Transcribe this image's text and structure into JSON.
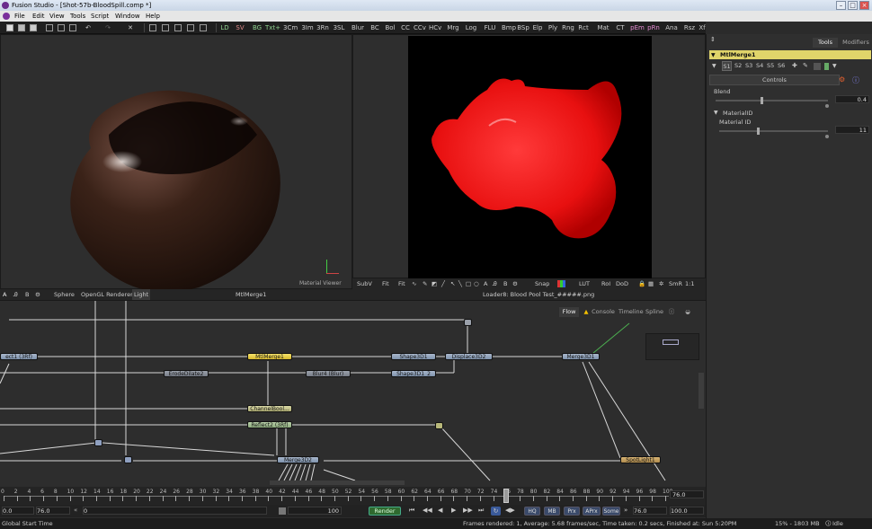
{
  "window": {
    "title": "Fusion Studio - [Shot-57b-BloodSpill.comp *]"
  },
  "menu": [
    "File",
    "Edit",
    "View",
    "Tools",
    "Script",
    "Window",
    "Help"
  ],
  "toolbar": {
    "tools": [
      "LD",
      "SV",
      "BG",
      "Txt+",
      "3Cm",
      "3Im",
      "3Rn",
      "3SL",
      "Blur",
      "BC",
      "Bol",
      "CC",
      "CCv",
      "HCv",
      "Mrg",
      "Log",
      "FLU",
      "Bmp",
      "BSp",
      "Elp",
      "Ply",
      "Rng",
      "Rct",
      "Mat",
      "CT",
      "pEm",
      "pRn",
      "Ana",
      "Rsz",
      "Xf"
    ]
  },
  "left_viewer": {
    "overlay_label": "Material Viewer",
    "bar": {
      "sphere": "Sphere",
      "renderer": "OpenGL Renderer",
      "light": "Light",
      "node": "MtlMerge1"
    }
  },
  "right_viewer": {
    "bar": {
      "subv": "SubV",
      "fit1": "Fit",
      "fit2": "Fit",
      "snap": "Snap",
      "lut": "LUT",
      "roi": "RoI",
      "dod": "DoD",
      "smr": "SmR",
      "ratio": "1:1"
    },
    "caption": "Loader8: Blood Pool Test_#####.png"
  },
  "inspector": {
    "tabs": {
      "tools": "Tools",
      "modifiers": "Modifiers"
    },
    "node_title": "MtlMerge1",
    "slots": [
      "S1",
      "S2",
      "S3",
      "S4",
      "S5",
      "S6"
    ],
    "controls_label": "Controls",
    "blend": {
      "label": "Blend",
      "value": "0.4"
    },
    "material_group": "MaterialID",
    "material_id": {
      "label": "Material ID",
      "value": "11"
    }
  },
  "flow_tabs": {
    "flow": "Flow",
    "console": "Console",
    "timeline": "Timeline",
    "spline": "Spline"
  },
  "nodes": {
    "reflect1": "ect1 (3Rf)",
    "mtlmerge1": "MtlMerge1",
    "shape3d1": "Shape3D1",
    "displace3d2": "Displace3D2",
    "merge3d1": "Merge3D1",
    "erodedilate2": "ErodeDilate2",
    "blur4": "Blur4 (Blur)",
    "shape3d1_2": "Shape3D1_2",
    "channelbool": "ChannelBool...",
    "reflect2": "Reflect2 (3Rf)",
    "merge3d2": "Merge3D2",
    "spotlight1": "SpotLight1"
  },
  "timeline": {
    "ticks": [
      "0",
      "2",
      "4",
      "6",
      "8",
      "10",
      "12",
      "14",
      "16",
      "18",
      "20",
      "22",
      "24",
      "26",
      "28",
      "30",
      "32",
      "34",
      "36",
      "38",
      "40",
      "42",
      "44",
      "46",
      "48",
      "50",
      "52",
      "54",
      "56",
      "58",
      "60",
      "62",
      "64",
      "66",
      "68",
      "70",
      "72",
      "74",
      "76",
      "78",
      "80",
      "82",
      "84",
      "86",
      "88",
      "90",
      "92",
      "94",
      "96",
      "98",
      "100"
    ],
    "end_value": "76.0"
  },
  "transport": {
    "start": "0.0",
    "render_end": "76.0",
    "current": "0",
    "zoom": "100",
    "render": "Render",
    "hq": "HQ",
    "mb": "MB",
    "prx": "Prx",
    "aprx": "APrx",
    "some": "Some",
    "end": "76.0",
    "global_end": "100.0"
  },
  "status": {
    "left": "Global Start Time",
    "message": "Frames rendered: 1,  Average: 5.68 frames/sec,  Time taken: 0.2 secs,  Finished at: Sun 5:20PM",
    "memory": "15% - 1803 MB",
    "state": "Idle"
  }
}
